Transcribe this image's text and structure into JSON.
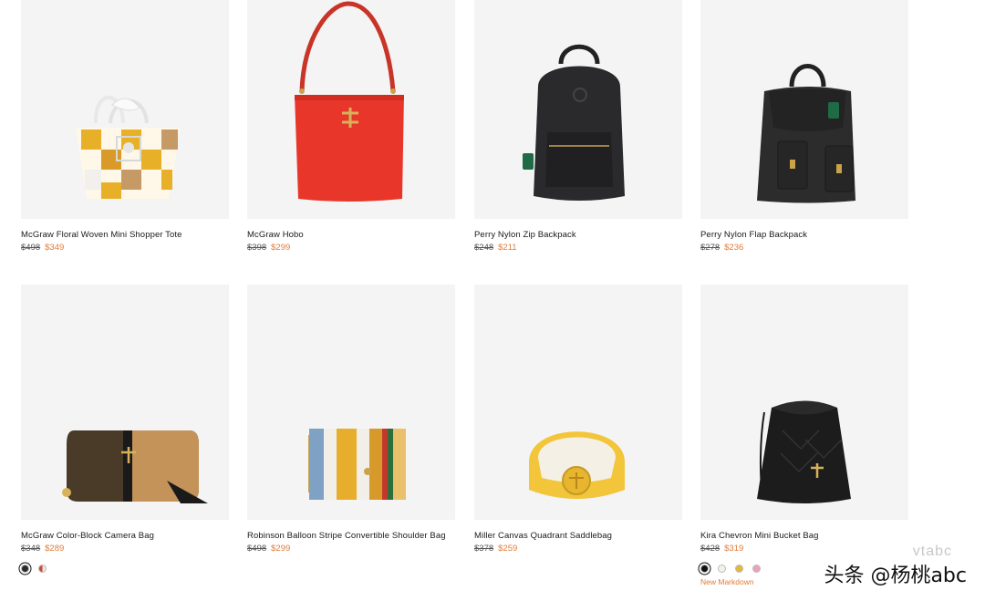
{
  "products": [
    {
      "name": "McGraw Floral Woven Mini Shopper Tote",
      "original_price": "$498",
      "sale_price": "$349"
    },
    {
      "name": "McGraw Hobo",
      "original_price": "$398",
      "sale_price": "$299"
    },
    {
      "name": "Perry Nylon Zip Backpack",
      "original_price": "$248",
      "sale_price": "$211"
    },
    {
      "name": "Perry Nylon Flap Backpack",
      "original_price": "$278",
      "sale_price": "$236"
    },
    {
      "name": "McGraw Color-Block Camera Bag",
      "original_price": "$348",
      "sale_price": "$289",
      "swatches": [
        "#2a2a2a",
        "#c94a3a"
      ]
    },
    {
      "name": "Robinson Balloon Stripe Convertible Shoulder Bag",
      "original_price": "$498",
      "sale_price": "$299"
    },
    {
      "name": "Miller Canvas Quadrant Saddlebag",
      "original_price": "$378",
      "sale_price": "$259"
    },
    {
      "name": "Kira Chevron Mini Bucket Bag",
      "original_price": "$428",
      "sale_price": "$319",
      "swatches": [
        "#111111",
        "#f4f1ea",
        "#e3b93a",
        "#e8a3b5"
      ],
      "badge": "New Markdown"
    }
  ],
  "watermark": {
    "text": "头条 @杨桃abc",
    "faint_text": "vtabc"
  },
  "colors": {
    "sale": "#e07b39",
    "image_bg": "#f4f4f4"
  }
}
